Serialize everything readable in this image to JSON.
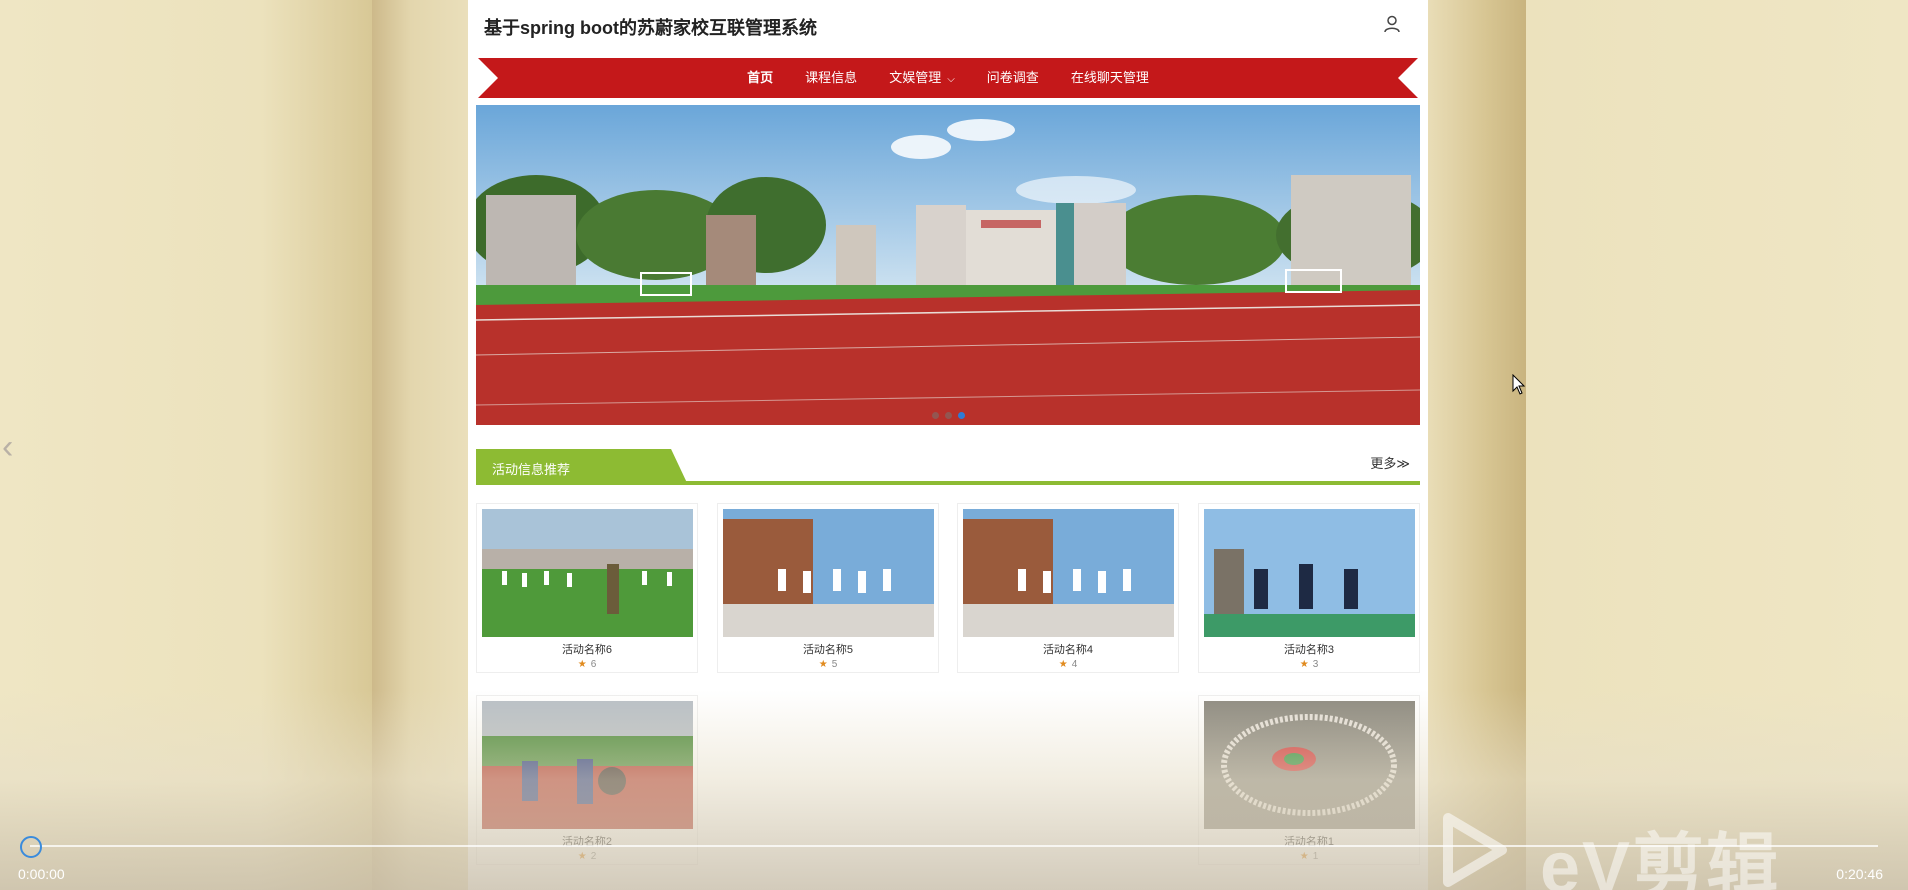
{
  "header": {
    "site_title": "基于spring boot的苏蔚家校互联管理系统"
  },
  "nav": {
    "items": [
      {
        "label": "首页",
        "active": true
      },
      {
        "label": "课程信息"
      },
      {
        "label": "文娱管理",
        "has_dropdown": true
      },
      {
        "label": "问卷调查"
      },
      {
        "label": "在线聊天管理"
      }
    ]
  },
  "banner": {
    "slide_count": 3,
    "active_slide": 3
  },
  "section": {
    "title": "活动信息推荐",
    "more_label": "更多≫"
  },
  "activities": [
    {
      "name": "活动名称6",
      "rating": "6"
    },
    {
      "name": "活动名称5",
      "rating": "5"
    },
    {
      "name": "活动名称4",
      "rating": "4"
    },
    {
      "name": "活动名称3",
      "rating": "3"
    },
    {
      "name": "活动名称2",
      "rating": "2"
    },
    {
      "name": "活动名称1",
      "rating": "1"
    }
  ],
  "player": {
    "current_time": "0:00:00",
    "total_time": "0:20:46",
    "progress": 0,
    "watermark": "eV剪辑"
  },
  "colors": {
    "nav_red": "#c4181a",
    "section_green": "#8dbb33",
    "star_orange": "#e08a1e",
    "progress_blue": "#3a8bdc"
  },
  "icons": [
    "user-icon",
    "star-icon",
    "chevron-down-icon",
    "chevron-left-icon",
    "play-icon",
    "cursor-icon"
  ]
}
